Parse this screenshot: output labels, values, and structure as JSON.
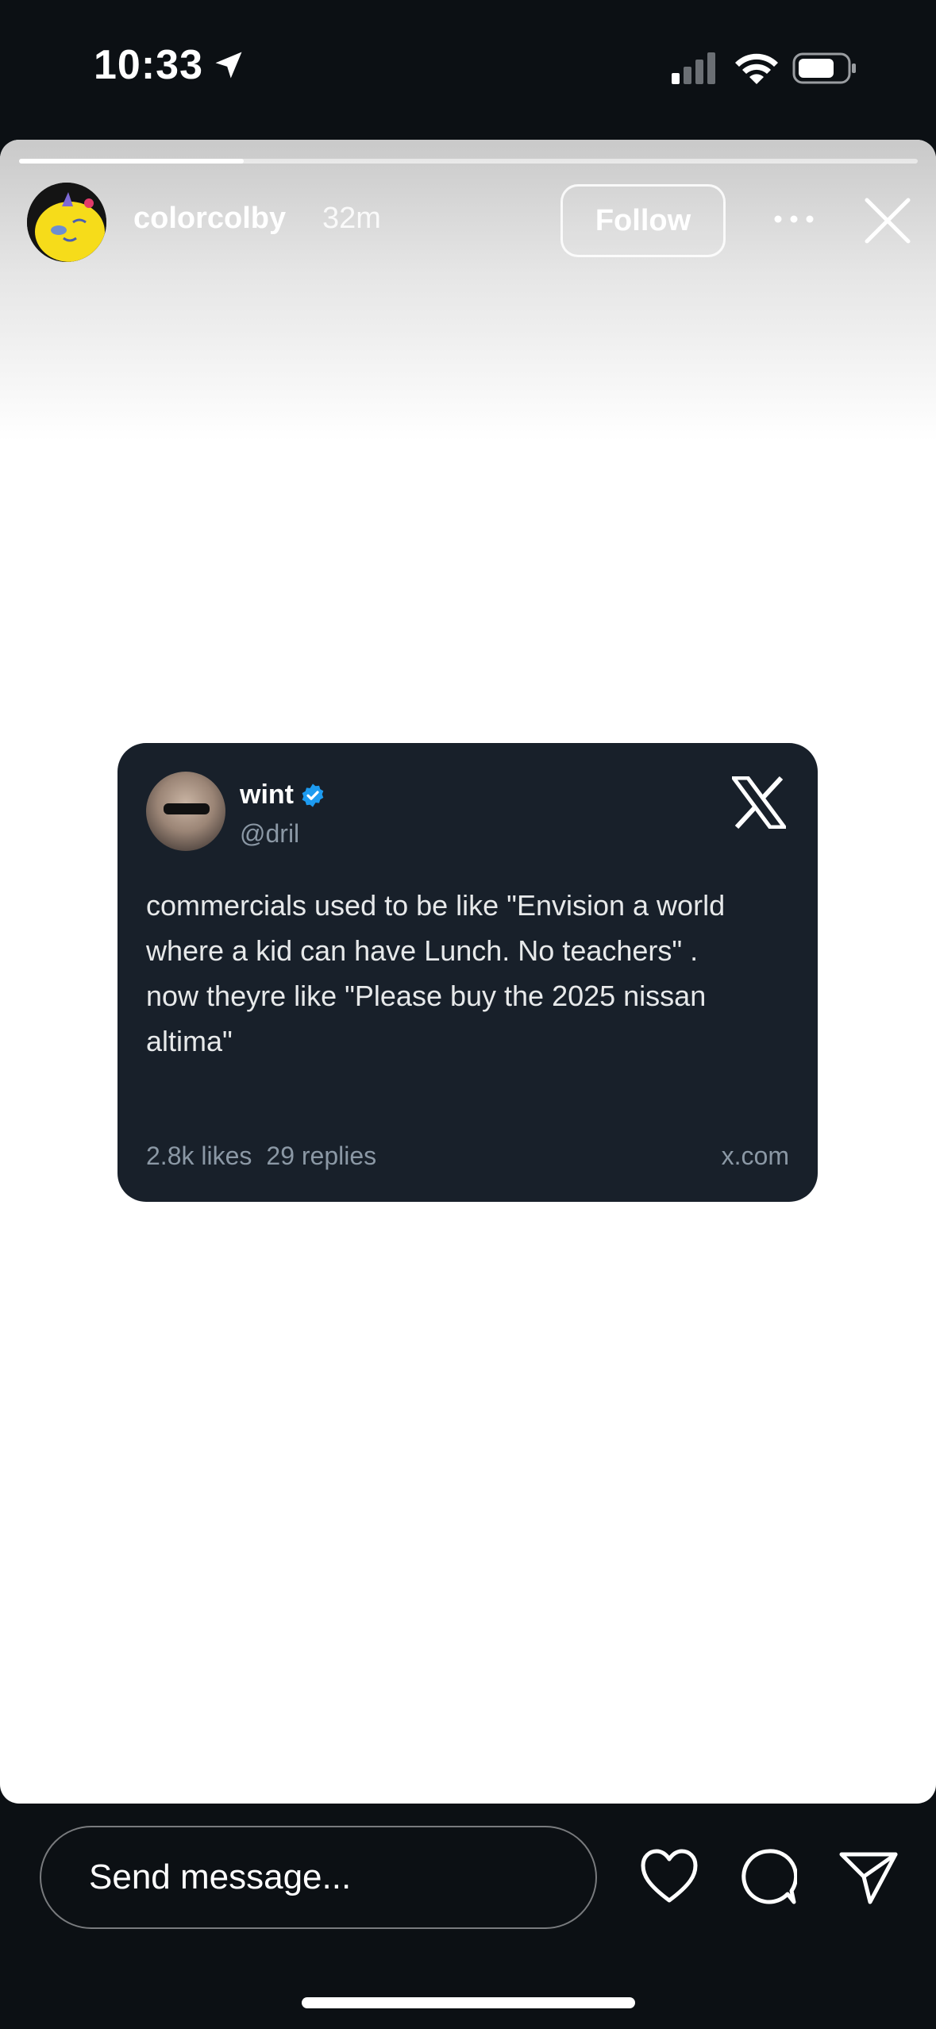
{
  "status_bar": {
    "time": "10:33",
    "location_icon": "location-arrow-icon",
    "signal_icon": "cellular-signal-icon",
    "wifi_icon": "wifi-icon",
    "battery_icon": "battery-icon"
  },
  "story": {
    "progress": 0.25,
    "username": "colorcolby",
    "timestamp": "32m",
    "follow_label": "Follow",
    "more_icon": "more-horizontal-icon",
    "close_icon": "close-icon"
  },
  "tweet": {
    "name": "wint",
    "handle": "@dril",
    "verified_icon": "verified-badge-icon",
    "platform_icon": "x-logo-icon",
    "text": "commercials used to be like \"Envision a world\nwhere a kid can have Lunch. No teachers\" .\nnow theyre like \"Please buy the 2025 nissan\naltima\"",
    "likes": "2.8k likes",
    "replies": "29 replies",
    "source": "x.com"
  },
  "bottom_bar": {
    "message_placeholder": "Send message...",
    "like_icon": "heart-icon",
    "comment_icon": "comment-bubble-icon",
    "share_icon": "send-paper-plane-icon"
  },
  "colors": {
    "background": "#0c1014",
    "tweet_card": "#18202a",
    "verified_blue": "#1d9bf0",
    "muted_text": "#8b98a5"
  }
}
